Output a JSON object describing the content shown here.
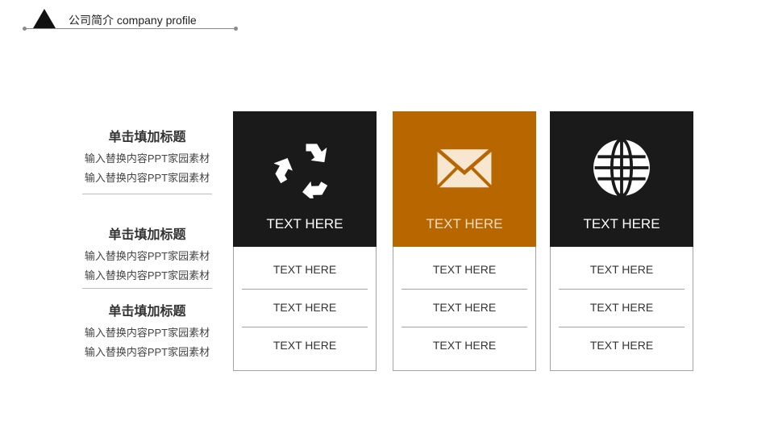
{
  "header": {
    "title": "公司简介  company profile"
  },
  "left": [
    {
      "title": "单击填加标题",
      "line1": "输入替换内容PPT家园素材",
      "line2": "输入替换内容PPT家园素材"
    },
    {
      "title": "单击填加标题",
      "line1": "输入替换内容PPT家园素材",
      "line2": "输入替换内容PPT家园素材"
    },
    {
      "title": "单击填加标题",
      "line1": "输入替换内容PPT家园素材",
      "line2": "输入替换内容PPT家园素材"
    }
  ],
  "cards": [
    {
      "icon": "recycle-icon",
      "color": "#1a1a1a",
      "label_color": "#ffffff",
      "label": "TEXT HERE",
      "rows": [
        "TEXT HERE",
        "TEXT HERE",
        "TEXT HERE"
      ]
    },
    {
      "icon": "envelope-icon",
      "color": "#b86600",
      "label_color": "#f2dcc0",
      "label": "TEXT HERE",
      "rows": [
        "TEXT HERE",
        "TEXT HERE",
        "TEXT HERE"
      ]
    },
    {
      "icon": "globe-icon",
      "color": "#1a1a1a",
      "label_color": "#ffffff",
      "label": "TEXT HERE",
      "rows": [
        "TEXT HERE",
        "TEXT HERE",
        "TEXT HERE"
      ]
    }
  ]
}
